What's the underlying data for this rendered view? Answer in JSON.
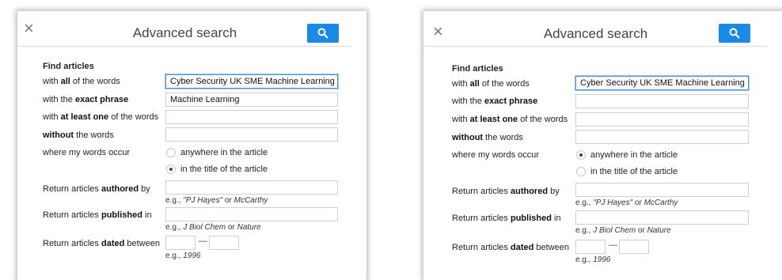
{
  "colors": {
    "accent": "#1a8ae6",
    "focus_border": "#4a90d9"
  },
  "icons": {
    "close": "close-icon",
    "search": "search-icon"
  },
  "panels": [
    {
      "close_glyph": "×",
      "title": "Advanced search",
      "section": "Find articles",
      "all_words": {
        "pre": "with ",
        "bold": "all",
        "post": " of the words",
        "value": "Cyber Security UK SME Machine Learning"
      },
      "exact_phrase": {
        "pre": "with the ",
        "bold": "exact phrase",
        "post": "",
        "value": "Machine Learning"
      },
      "at_least_one": {
        "pre": "with ",
        "bold": "at least one",
        "post": " of the words",
        "value": ""
      },
      "without": {
        "pre": "",
        "bold": "without",
        "post": " the words",
        "value": ""
      },
      "where": {
        "label": "where my words occur",
        "options": [
          "anywhere in the article",
          "in the title of the article"
        ],
        "selected": 1
      },
      "authored": {
        "pre": "Return articles ",
        "bold": "authored",
        "post": " by",
        "value": "",
        "hint_pre": "e.g., ",
        "hint_ex1": "\"PJ Hayes\"",
        "hint_mid": " or ",
        "hint_ex2": "McCarthy"
      },
      "published": {
        "pre": "Return articles ",
        "bold": "published",
        "post": " in",
        "value": "",
        "hint_pre": "e.g., ",
        "hint_ex1": "J Biol Chem",
        "hint_mid": " or ",
        "hint_ex2": "Nature"
      },
      "dated": {
        "pre": "Return articles ",
        "bold": "dated",
        "post": " between",
        "from": "",
        "to": "",
        "dash": "—",
        "hint_pre": "e.g., ",
        "hint_ex": "1996"
      }
    },
    {
      "close_glyph": "×",
      "title": "Advanced search",
      "section": "Find articles",
      "all_words": {
        "pre": "with ",
        "bold": "all",
        "post": " of the words",
        "value": "Cyber Security UK SME Machine Learning"
      },
      "exact_phrase": {
        "pre": "with the ",
        "bold": "exact phrase",
        "post": "",
        "value": ""
      },
      "at_least_one": {
        "pre": "with ",
        "bold": "at least one",
        "post": " of the words",
        "value": ""
      },
      "without": {
        "pre": "",
        "bold": "without",
        "post": " the words",
        "value": ""
      },
      "where": {
        "label": "where my words occur",
        "options": [
          "anywhere in the article",
          "in the title of the article"
        ],
        "selected": 0
      },
      "authored": {
        "pre": "Return articles ",
        "bold": "authored",
        "post": " by",
        "value": "",
        "hint_pre": "e.g., ",
        "hint_ex1": "\"PJ Hayes\"",
        "hint_mid": " or ",
        "hint_ex2": "McCarthy"
      },
      "published": {
        "pre": "Return articles ",
        "bold": "published",
        "post": " in",
        "value": "",
        "hint_pre": "e.g., ",
        "hint_ex1": "J Biol Chem",
        "hint_mid": " or ",
        "hint_ex2": "Nature"
      },
      "dated": {
        "pre": "Return articles ",
        "bold": "dated",
        "post": " between",
        "from": "",
        "to": "",
        "dash": "—",
        "hint_pre": "e.g., ",
        "hint_ex": "1996"
      }
    }
  ]
}
